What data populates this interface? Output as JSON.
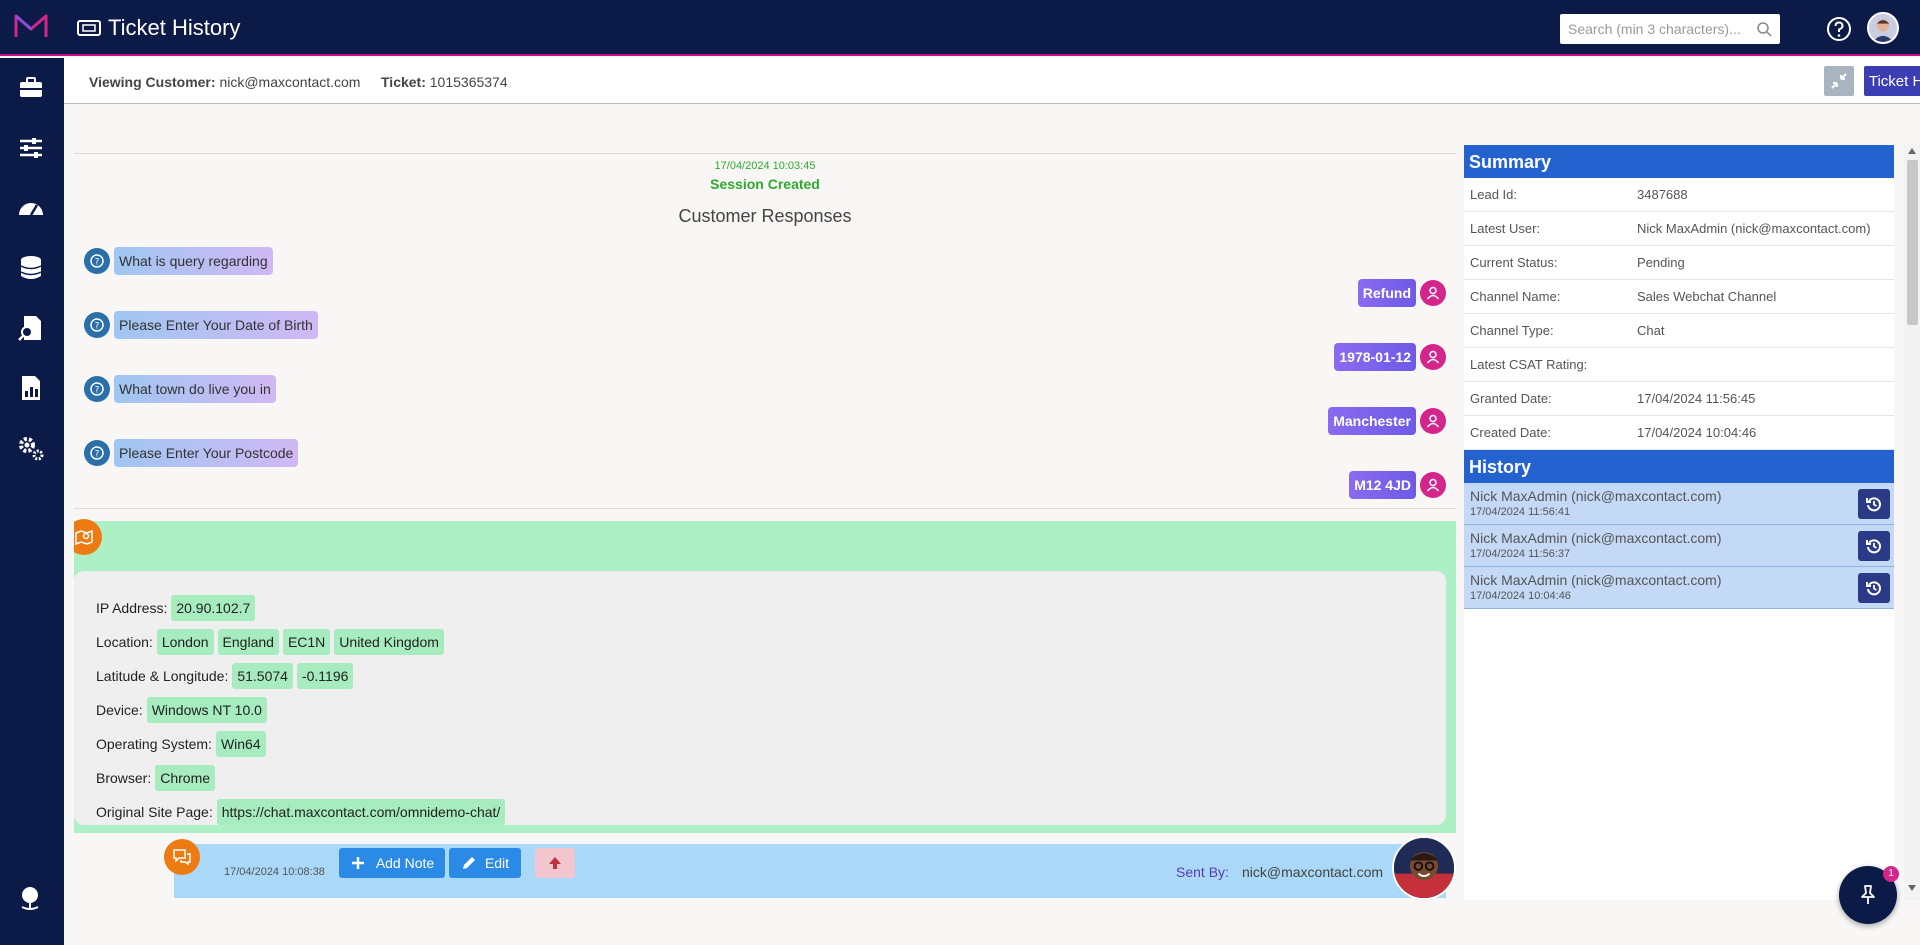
{
  "app": {
    "title": "Ticket History"
  },
  "search": {
    "placeholder": "Search (min 3 characters)..."
  },
  "subheader": {
    "customer_label": "Viewing Customer:",
    "customer_value": "nick@maxcontact.com",
    "ticket_label": "Ticket:",
    "ticket_value": "1015365374",
    "history_button": "Ticket History"
  },
  "chat": {
    "session_time": "17/04/2024 10:03:45",
    "session_text": "Session Created",
    "responses_title": "Customer Responses",
    "qa": [
      {
        "question": "What is query regarding",
        "answer": "Refund"
      },
      {
        "question": "Please Enter Your Date of Birth",
        "answer": "1978-01-12"
      },
      {
        "question": "What town do live you in",
        "answer": "Manchester"
      },
      {
        "question": "Please Enter Your Postcode",
        "answer": "M12 4JD"
      }
    ],
    "geo": {
      "ip_label": "IP Address:",
      "ip": "20.90.102.7",
      "location_label": "Location:",
      "location": [
        "London",
        "England",
        "EC1N",
        "United Kingdom"
      ],
      "latlng_label": "Latitude & Longitude:",
      "lat": "51.5074",
      "lng": "-0.1196",
      "device_label": "Device:",
      "device": "Windows NT 10.0",
      "os_label": "Operating System:",
      "os": "Win64",
      "browser_label": "Browser:",
      "browser": "Chrome",
      "site_label": "Original Site Page:",
      "site": "https://chat.maxcontact.com/omnidemo-chat/"
    },
    "note": {
      "timestamp": "17/04/2024 10:08:38",
      "add_note": "Add Note",
      "edit": "Edit",
      "sent_by_label": "Sent By:",
      "sent_by_value": "nick@maxcontact.com"
    }
  },
  "summary": {
    "title": "Summary",
    "rows": [
      {
        "key": "Lead Id:",
        "value": "3487688"
      },
      {
        "key": "Latest User:",
        "value": "Nick MaxAdmin (nick@maxcontact.com)"
      },
      {
        "key": "Current Status:",
        "value": "Pending"
      },
      {
        "key": "Channel Name:",
        "value": "Sales Webchat Channel"
      },
      {
        "key": "Channel Type:",
        "value": "Chat"
      },
      {
        "key": "Latest CSAT Rating:",
        "value": ""
      },
      {
        "key": "Granted Date:",
        "value": "17/04/2024 11:56:45"
      },
      {
        "key": "Created Date:",
        "value": "17/04/2024 10:04:46"
      }
    ]
  },
  "history": {
    "title": "History",
    "items": [
      {
        "name": "Nick MaxAdmin (nick@maxcontact.com)",
        "date": "17/04/2024 11:56:41"
      },
      {
        "name": "Nick MaxAdmin (nick@maxcontact.com)",
        "date": "17/04/2024 11:56:37"
      },
      {
        "name": "Nick MaxAdmin (nick@maxcontact.com)",
        "date": "17/04/2024 10:04:46"
      }
    ]
  },
  "fab": {
    "badge": "1"
  },
  "colors": {
    "navy": "#0b1a46",
    "accent": "#c3117f",
    "blue": "#2463cf"
  }
}
